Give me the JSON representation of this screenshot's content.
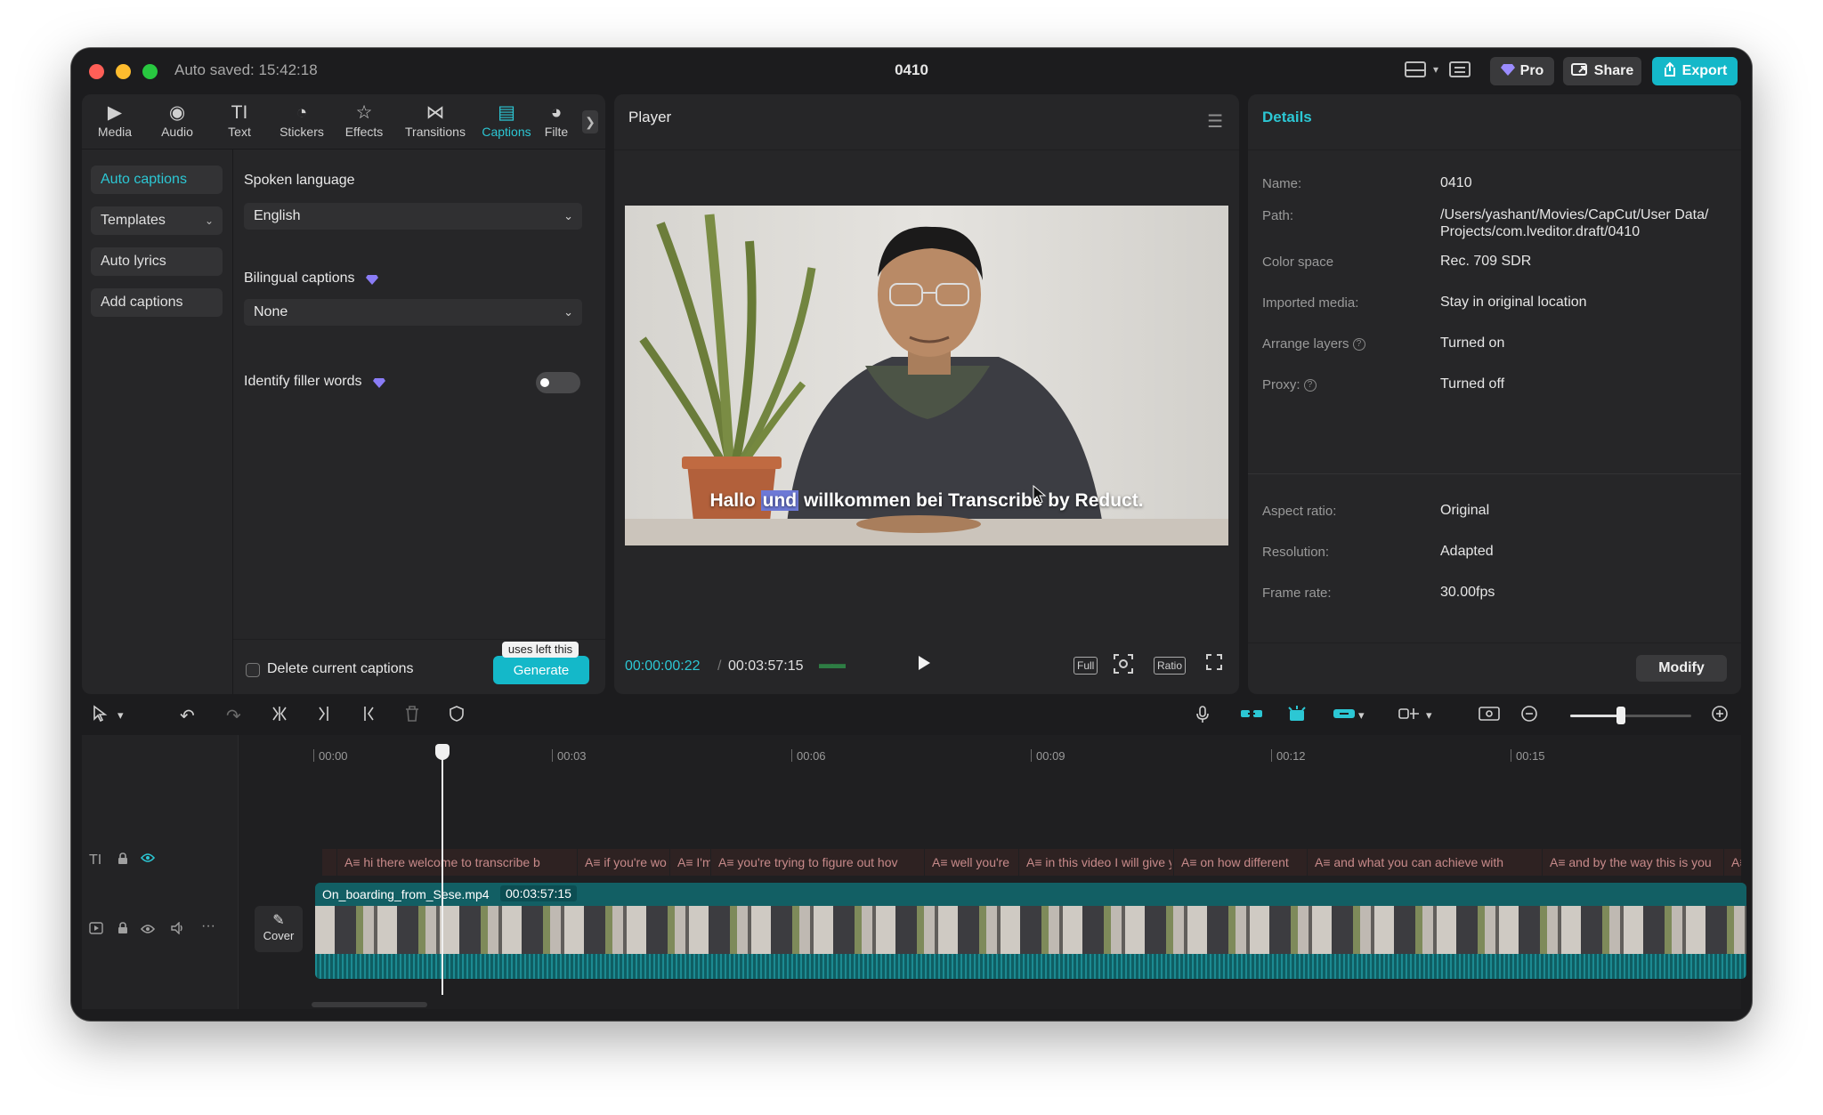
{
  "titlebar": {
    "autosaved": "Auto saved: 15:42:18",
    "title": "0410",
    "pro_label": "Pro",
    "share_label": "Share",
    "export_label": "Export"
  },
  "tabs": [
    {
      "label": "Media",
      "icon": "media-icon"
    },
    {
      "label": "Audio",
      "icon": "audio-icon"
    },
    {
      "label": "Text",
      "icon": "text-icon"
    },
    {
      "label": "Stickers",
      "icon": "stickers-icon"
    },
    {
      "label": "Effects",
      "icon": "effects-icon"
    },
    {
      "label": "Transitions",
      "icon": "transitions-icon"
    },
    {
      "label": "Captions",
      "icon": "captions-icon",
      "active": true
    },
    {
      "label": "Filte",
      "icon": "filters-icon"
    }
  ],
  "sidebar": {
    "items": [
      {
        "label": "Auto captions",
        "active": true
      },
      {
        "label": "Templates"
      },
      {
        "label": "Auto lyrics"
      },
      {
        "label": "Add captions"
      }
    ]
  },
  "captions": {
    "spoken_language_label": "Spoken language",
    "spoken_language_value": "English",
    "bilingual_label": "Bilingual captions",
    "bilingual_value": "None",
    "filler_label": "Identify filler words",
    "filler_on": false,
    "delete_label": "Delete current captions",
    "generate_label": "Generate",
    "tooltip": "uses left this"
  },
  "player": {
    "title": "Player",
    "subtitle_before": "Hallo ",
    "subtitle_highlight": "und",
    "subtitle_after": " willkommen bei Transcribe by Reduct.",
    "current_time": "00:00:00:22",
    "total_time": "00:03:57:15",
    "full_label": "Full",
    "ratio_label": "Ratio"
  },
  "details": {
    "title": "Details",
    "rows": [
      {
        "label": "Name:",
        "value": "0410"
      },
      {
        "label": "Path:",
        "value": "/Users/yashant/Movies/CapCut/User Data/",
        "value2": "Projects/com.lveditor.draft/0410"
      },
      {
        "label": "Color space",
        "value": "Rec. 709 SDR"
      },
      {
        "label": "Imported media:",
        "value": "Stay in original location"
      },
      {
        "label": "Arrange layers",
        "value": "Turned on"
      },
      {
        "label": "Proxy:",
        "value": "Turned off"
      },
      {
        "label": "Aspect ratio:",
        "value": "Original"
      },
      {
        "label": "Resolution:",
        "value": "Adapted"
      },
      {
        "label": "Frame rate:",
        "value": "30.00fps"
      }
    ],
    "modify_label": "Modify"
  },
  "timeline": {
    "ruler": [
      "00:00",
      "00:03",
      "00:06",
      "00:09",
      "00:12",
      "00:15"
    ],
    "caption_segments": [
      "A≡ hi there welcome to transcribe b",
      "A≡ if you're wo",
      "A≡ I'm",
      "A≡ you're trying to figure out hov",
      "A≡ well you're",
      "A≡ in this video I will give yo",
      "A≡ on how different",
      "A≡ and what you can achieve with",
      "A≡ and by the way this is you",
      "A≡"
    ],
    "clip_name": "On_boarding_from_Sese.mp4",
    "clip_duration": "00:03:57:15",
    "cover_label": "Cover",
    "zoom_level": 0.42
  },
  "colors": {
    "accent": "#2cc7d4",
    "export": "#14b8c9",
    "highlight": "#6d79d6",
    "clip": "#0f5e63"
  }
}
